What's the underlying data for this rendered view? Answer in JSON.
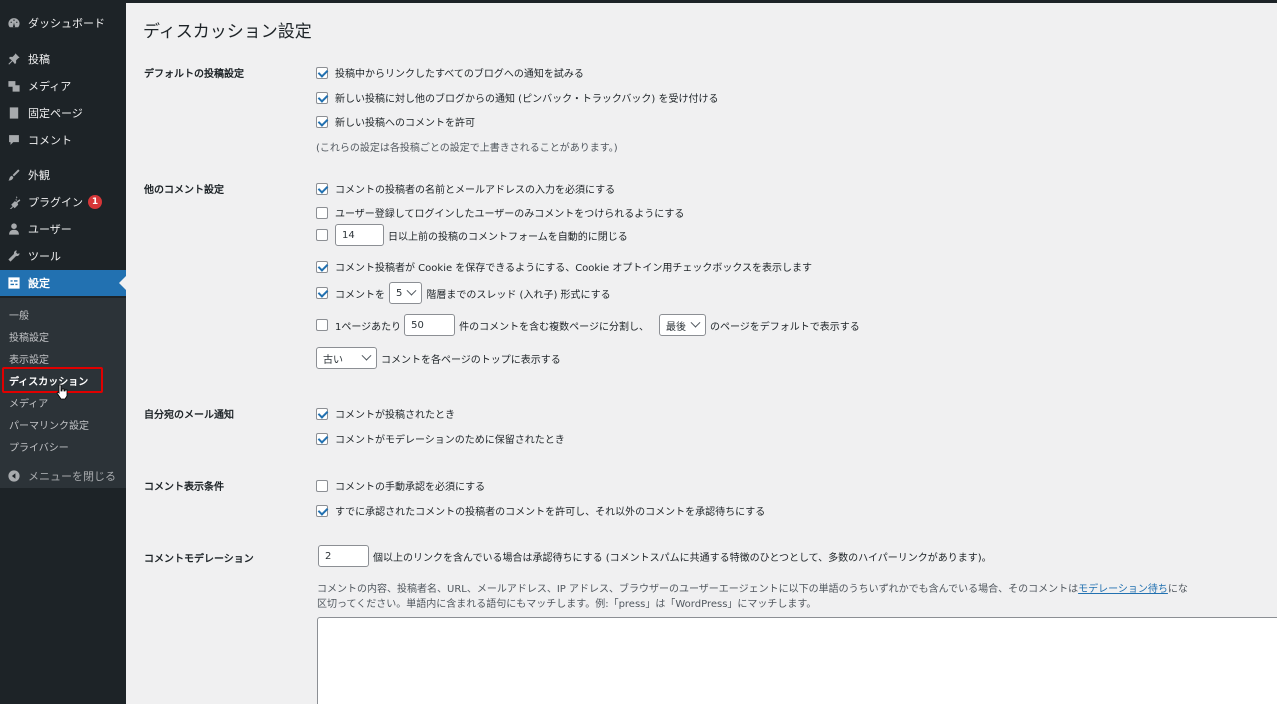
{
  "sidebar": {
    "items": [
      {
        "label": "ダッシュボード",
        "icon": "dashboard-icon"
      },
      {
        "label": "投稿",
        "icon": "pin-icon"
      },
      {
        "label": "メディア",
        "icon": "media-icon"
      },
      {
        "label": "固定ページ",
        "icon": "page-icon"
      },
      {
        "label": "コメント",
        "icon": "comment-icon"
      },
      {
        "label": "外観",
        "icon": "brush-icon"
      },
      {
        "label": "プラグイン",
        "icon": "plugin-icon",
        "badge": "1"
      },
      {
        "label": "ユーザー",
        "icon": "user-icon"
      },
      {
        "label": "ツール",
        "icon": "wrench-icon"
      },
      {
        "label": "設定",
        "icon": "settings-icon"
      }
    ],
    "submenu": [
      "一般",
      "投稿設定",
      "表示設定",
      "ディスカッション",
      "メディア",
      "パーマリンク設定",
      "プライバシー"
    ],
    "collapse_label": "メニューを閉じる"
  },
  "page": {
    "title": "ディスカッション設定",
    "default_post": {
      "label": "デフォルトの投稿設定",
      "opt1": "投稿中からリンクしたすべてのブログへの通知を試みる",
      "opt2": "新しい投稿に対し他のブログからの通知 (ピンバック・トラックバック) を受け付ける",
      "opt3": "新しい投稿へのコメントを許可",
      "note": "(これらの設定は各投稿ごとの設定で上書きされることがあります。)"
    },
    "other_comment": {
      "label": "他のコメント設定",
      "opt1": "コメントの投稿者の名前とメールアドレスの入力を必須にする",
      "opt2": "ユーザー登録してログインしたユーザーのみコメントをつけられるようにする",
      "close_days": "14",
      "close_text": "日以上前の投稿のコメントフォームを自動的に閉じる",
      "opt_cookie": "コメント投稿者が Cookie を保存できるようにする、Cookie オプトイン用チェックボックスを表示します",
      "thread_pre": "コメントを",
      "thread_depth": "5",
      "thread_post": "階層までのスレッド (入れ子) 形式にする",
      "paged_pre": "1ページあたり",
      "per_page": "50",
      "paged_mid": "件のコメントを含む複数ページに分割し、",
      "default_page": "最後",
      "paged_post": "のページをデフォルトで表示する",
      "order": "古い",
      "order_post": "コメントを各ページのトップに表示する"
    },
    "email": {
      "label": "自分宛のメール通知",
      "opt1": "コメントが投稿されたとき",
      "opt2": "コメントがモデレーションのために保留されたとき"
    },
    "appear": {
      "label": "コメント表示条件",
      "opt1": "コメントの手動承認を必須にする",
      "opt2": "すでに承認されたコメントの投稿者のコメントを許可し、それ以外のコメントを承認待ちにする"
    },
    "moderation": {
      "label": "コメントモデレーション",
      "links": "2",
      "links_text": "個以上のリンクを含んでいる場合は承認待ちにする (コメントスパムに共通する特徴のひとつとして、多数のハイパーリンクがあります)。",
      "desc1": "コメントの内容、投稿者名、URL、メールアドレス、IP アドレス、ブラウザーのユーザーエージェントに以下の単語のうちいずれかでも含んでいる場合、そのコメントは",
      "desc_link": "モデレーション待ち",
      "desc1b": "にな",
      "desc2": "区切ってください。単語内に含まれる語句にもマッチします。例:「press」は「WordPress」にマッチします。"
    }
  }
}
